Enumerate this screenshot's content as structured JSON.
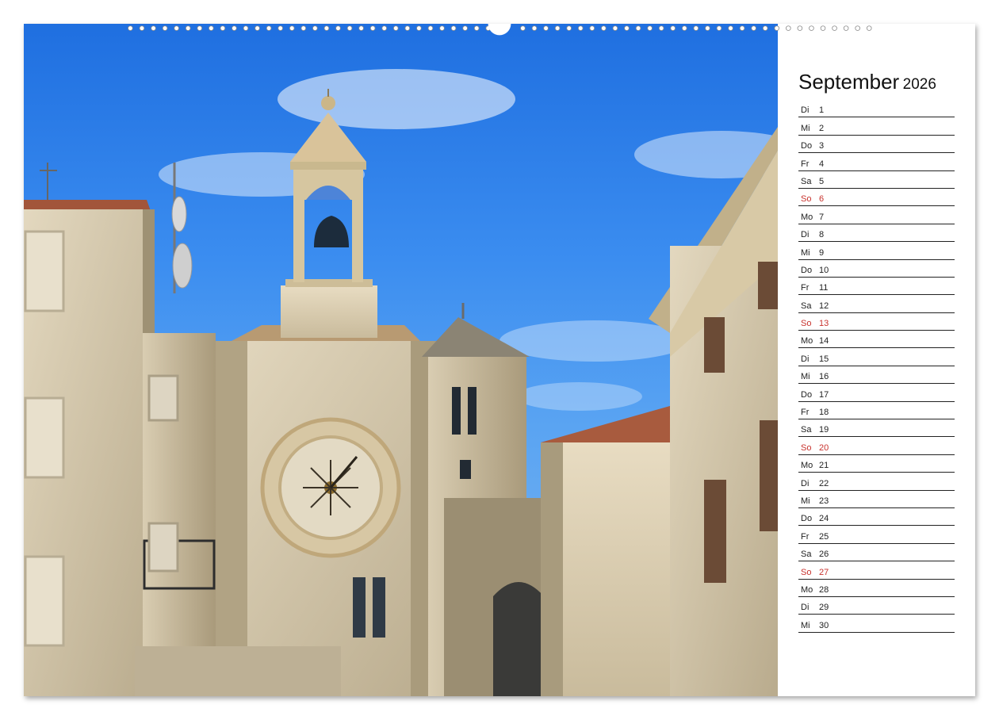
{
  "calendar": {
    "month": "September",
    "year": "2026",
    "days": [
      {
        "wd": "Di",
        "day": "1",
        "sunday": false
      },
      {
        "wd": "Mi",
        "day": "2",
        "sunday": false
      },
      {
        "wd": "Do",
        "day": "3",
        "sunday": false
      },
      {
        "wd": "Fr",
        "day": "4",
        "sunday": false
      },
      {
        "wd": "Sa",
        "day": "5",
        "sunday": false
      },
      {
        "wd": "So",
        "day": "6",
        "sunday": true
      },
      {
        "wd": "Mo",
        "day": "7",
        "sunday": false
      },
      {
        "wd": "Di",
        "day": "8",
        "sunday": false
      },
      {
        "wd": "Mi",
        "day": "9",
        "sunday": false
      },
      {
        "wd": "Do",
        "day": "10",
        "sunday": false
      },
      {
        "wd": "Fr",
        "day": "11",
        "sunday": false
      },
      {
        "wd": "Sa",
        "day": "12",
        "sunday": false
      },
      {
        "wd": "So",
        "day": "13",
        "sunday": true
      },
      {
        "wd": "Mo",
        "day": "14",
        "sunday": false
      },
      {
        "wd": "Di",
        "day": "15",
        "sunday": false
      },
      {
        "wd": "Mi",
        "day": "16",
        "sunday": false
      },
      {
        "wd": "Do",
        "day": "17",
        "sunday": false
      },
      {
        "wd": "Fr",
        "day": "18",
        "sunday": false
      },
      {
        "wd": "Sa",
        "day": "19",
        "sunday": false
      },
      {
        "wd": "So",
        "day": "20",
        "sunday": true
      },
      {
        "wd": "Mo",
        "day": "21",
        "sunday": false
      },
      {
        "wd": "Di",
        "day": "22",
        "sunday": false
      },
      {
        "wd": "Mi",
        "day": "23",
        "sunday": false
      },
      {
        "wd": "Do",
        "day": "24",
        "sunday": false
      },
      {
        "wd": "Fr",
        "day": "25",
        "sunday": false
      },
      {
        "wd": "Sa",
        "day": "26",
        "sunday": false
      },
      {
        "wd": "So",
        "day": "27",
        "sunday": true
      },
      {
        "wd": "Mo",
        "day": "28",
        "sunday": false
      },
      {
        "wd": "Di",
        "day": "29",
        "sunday": false
      },
      {
        "wd": "Mi",
        "day": "30",
        "sunday": false
      }
    ]
  },
  "colors": {
    "sunday": "#c8322d",
    "sky": "#3b8df0",
    "stone": "#d8cdb4"
  },
  "photo": {
    "icon": "old-town-clock-tower-photo"
  }
}
